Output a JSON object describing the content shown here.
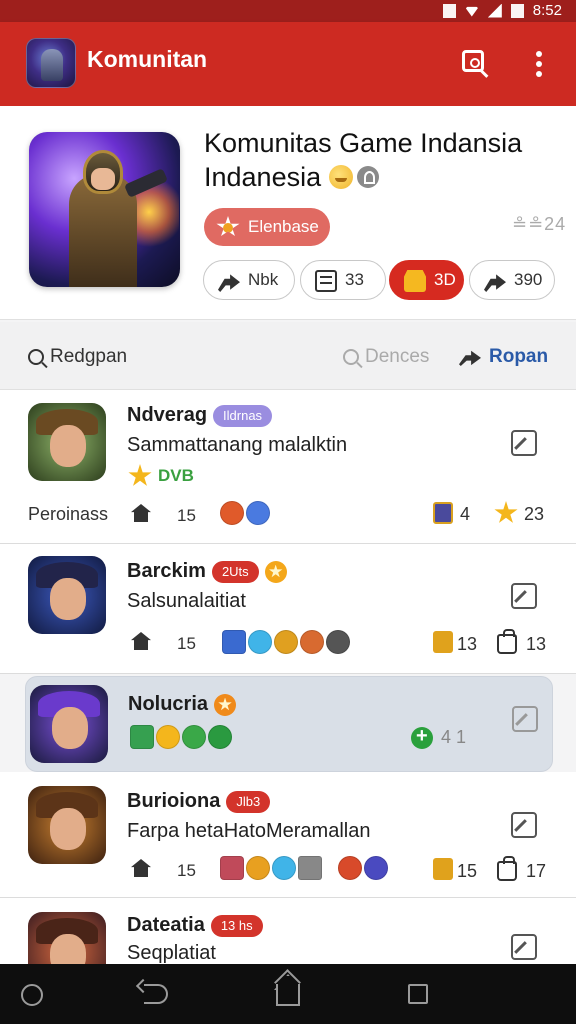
{
  "status_bar": {
    "time": "8:52"
  },
  "app_bar": {
    "title": "Komunitan",
    "icons": {
      "logo": "game-character-logo-icon",
      "search": "search-icon",
      "more": "more-vertical-icon"
    }
  },
  "hero": {
    "title_line1": "Komunitas Game Indansia",
    "title_line2": "Indanesia",
    "badge_label": "Elenbase",
    "member_count": "≗≗24",
    "actions": [
      {
        "label": "Nbk",
        "icon": "share-arrow-icon"
      },
      {
        "label": "33",
        "icon": "list-icon"
      },
      {
        "label": "3D",
        "icon": "gold-badge-icon"
      },
      {
        "label": "390",
        "icon": "forward-arrow-icon"
      }
    ]
  },
  "filters": {
    "left": "Redgpan",
    "middle": "Dences",
    "right": "Ropan"
  },
  "rows": [
    {
      "name": "Ndverag",
      "tag": "Ildrnas",
      "subtitle": "Sammattanang malalktin",
      "sub_badge": "DVB",
      "meta_label": "Peroinass",
      "home_count": "15",
      "trophy_count": "4",
      "star_count": "23"
    },
    {
      "name": "Barckim",
      "tag": "2Uts",
      "subtitle": "Salsunalaitiat",
      "home_count": "15",
      "trophy_count": "13",
      "bag_count": "13"
    },
    {
      "name": "Nolucria",
      "count": "4 1"
    },
    {
      "name": "Burioiona",
      "tag": "Jlb3",
      "subtitle": "Farpa hetaHatoMeramallan",
      "home_count": "15",
      "trophy_count": "15",
      "bag_count": "17"
    },
    {
      "name": "Dateatia",
      "tag": "13 hs",
      "subtitle": "Seqplatiat"
    }
  ],
  "colors": {
    "app_bar": "#cd2a22",
    "status_bar": "#9e1f1c",
    "accent_blue": "#2a5aa8",
    "tag_purple": "#9a8de0",
    "tag_red": "#d3342b",
    "selected_row": "#d9dfe7"
  },
  "nav": {
    "icons": [
      "circle-icon",
      "back-icon",
      "home-icon",
      "recent-apps-icon"
    ]
  }
}
